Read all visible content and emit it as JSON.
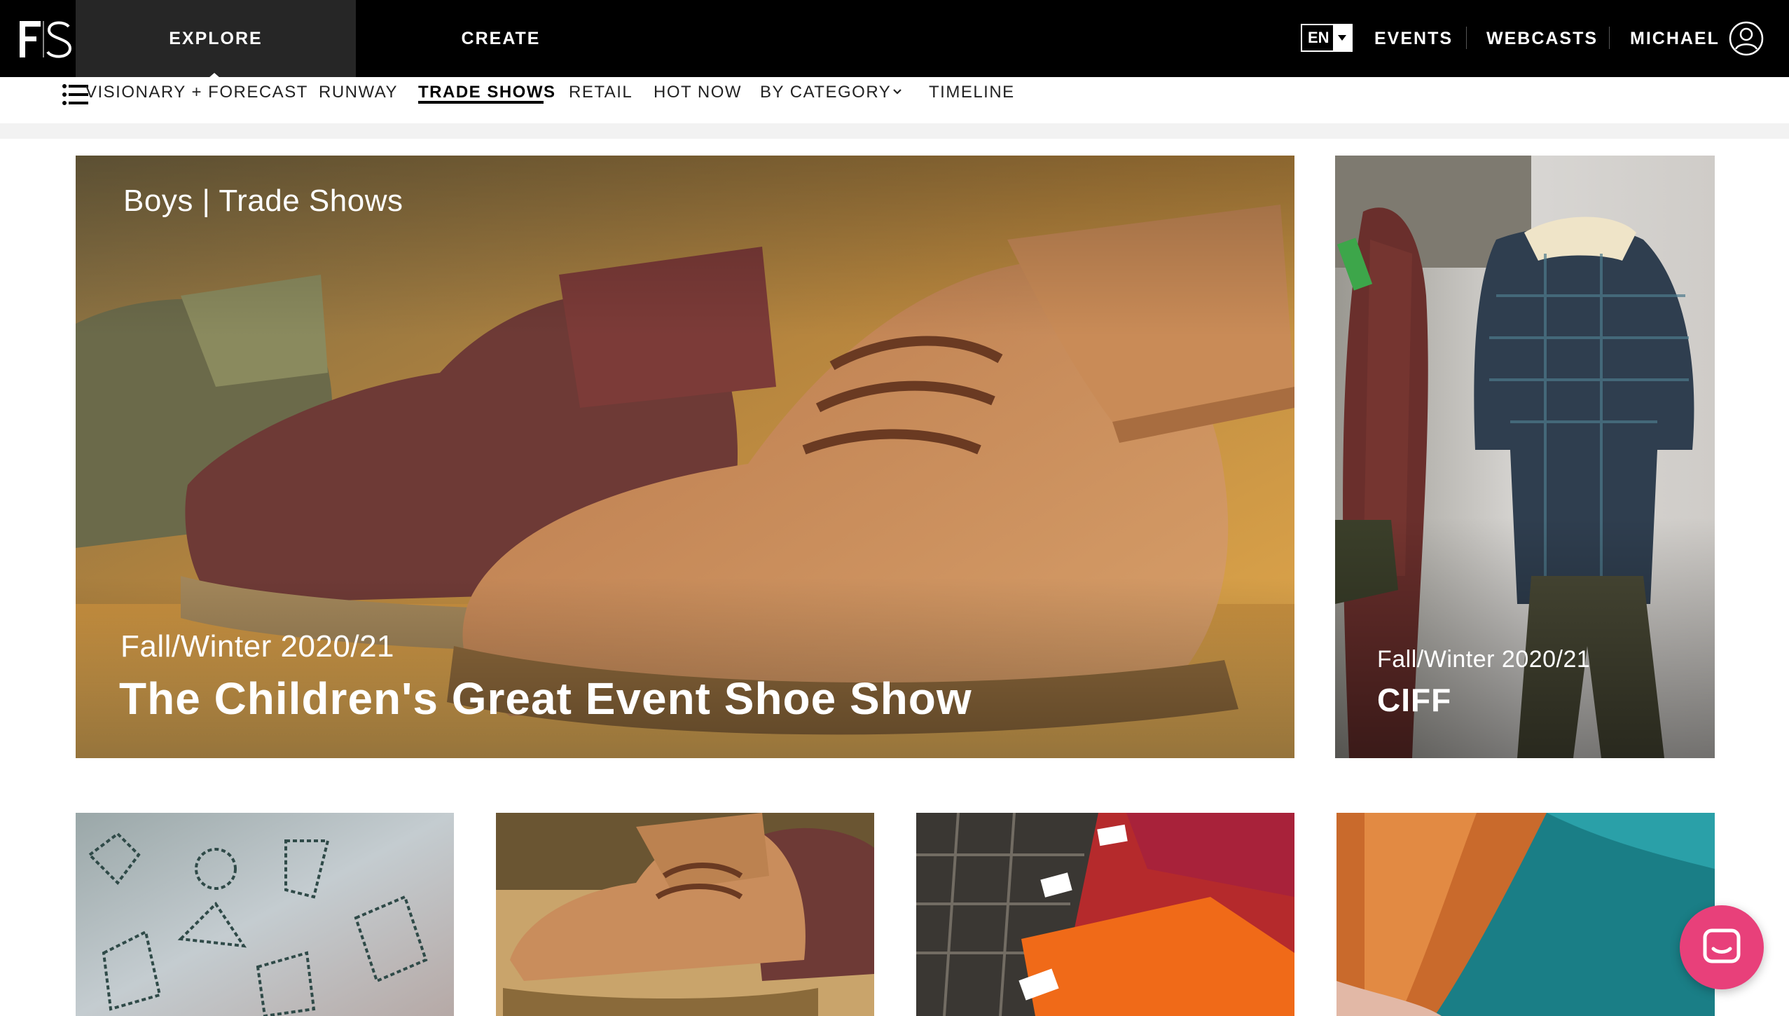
{
  "brand": {
    "logo_text": "FS"
  },
  "top_nav": {
    "tabs": [
      {
        "label": "EXPLORE",
        "active": true
      },
      {
        "label": "CREATE",
        "active": false
      }
    ],
    "language": "EN",
    "links": [
      "EVENTS",
      "WEBCASTS"
    ],
    "user_name": "MICHAEL"
  },
  "sub_nav": {
    "items": [
      {
        "label": "VISIONARY + FORECAST"
      },
      {
        "label": "RUNWAY"
      },
      {
        "label": "TRADE SHOWS",
        "active": true
      },
      {
        "label": "RETAIL"
      },
      {
        "label": "HOT NOW"
      },
      {
        "label": "BY CATEGORY",
        "has_dropdown": true
      },
      {
        "label": "TIMELINE"
      }
    ]
  },
  "hero": {
    "category": "Boys | Trade Shows",
    "season": "Fall/Winter 2020/21",
    "title": "The Children's Great Event Shoe Show"
  },
  "side_card": {
    "season": "Fall/Winter 2020/21",
    "title": "CIFF"
  },
  "colors": {
    "topbar": "#000000",
    "active_tab": "#262626",
    "chat_button": "#e8407a"
  },
  "icons": {
    "menu": "hamburger-list-icon",
    "user": "user-circle-icon",
    "chat": "chat-bubble-icon",
    "dropdown": "chevron-down-icon"
  }
}
